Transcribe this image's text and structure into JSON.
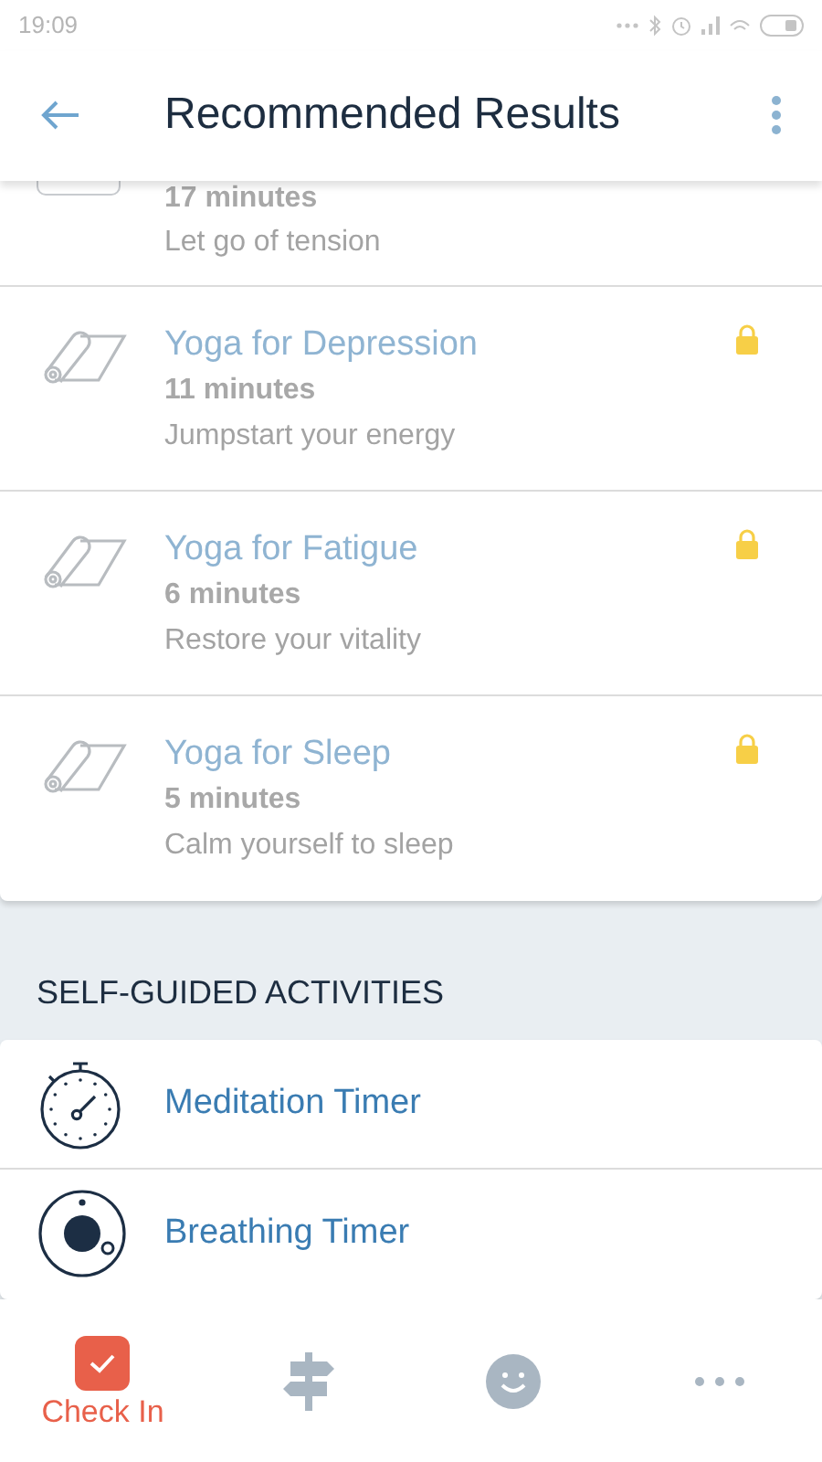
{
  "status_bar": {
    "time": "19:09"
  },
  "header": {
    "title": "Recommended Results"
  },
  "results": [
    {
      "kind": "cut",
      "minutes": "17 minutes",
      "subtitle": "Let go of tension"
    },
    {
      "kind": "full",
      "title": "Yoga for Depression",
      "minutes": "11 minutes",
      "subtitle": "Jumpstart your energy",
      "locked": true
    },
    {
      "kind": "full",
      "title": "Yoga for Fatigue",
      "minutes": "6 minutes",
      "subtitle": "Restore your vitality",
      "locked": true
    },
    {
      "kind": "full",
      "title": "Yoga for Sleep",
      "minutes": "5 minutes",
      "subtitle": "Calm yourself to sleep",
      "locked": true
    }
  ],
  "section": {
    "heading": "SELF-GUIDED ACTIVITIES",
    "items": [
      {
        "kind": "stopwatch",
        "label": "Meditation Timer"
      },
      {
        "kind": "breathing",
        "label": "Breathing Timer"
      }
    ]
  },
  "bottom_nav": [
    {
      "kind": "checkin",
      "label": "Check In",
      "selected": true
    },
    {
      "kind": "signpost",
      "selected": false
    },
    {
      "kind": "smiley",
      "selected": false
    },
    {
      "kind": "more",
      "selected": false
    }
  ]
}
